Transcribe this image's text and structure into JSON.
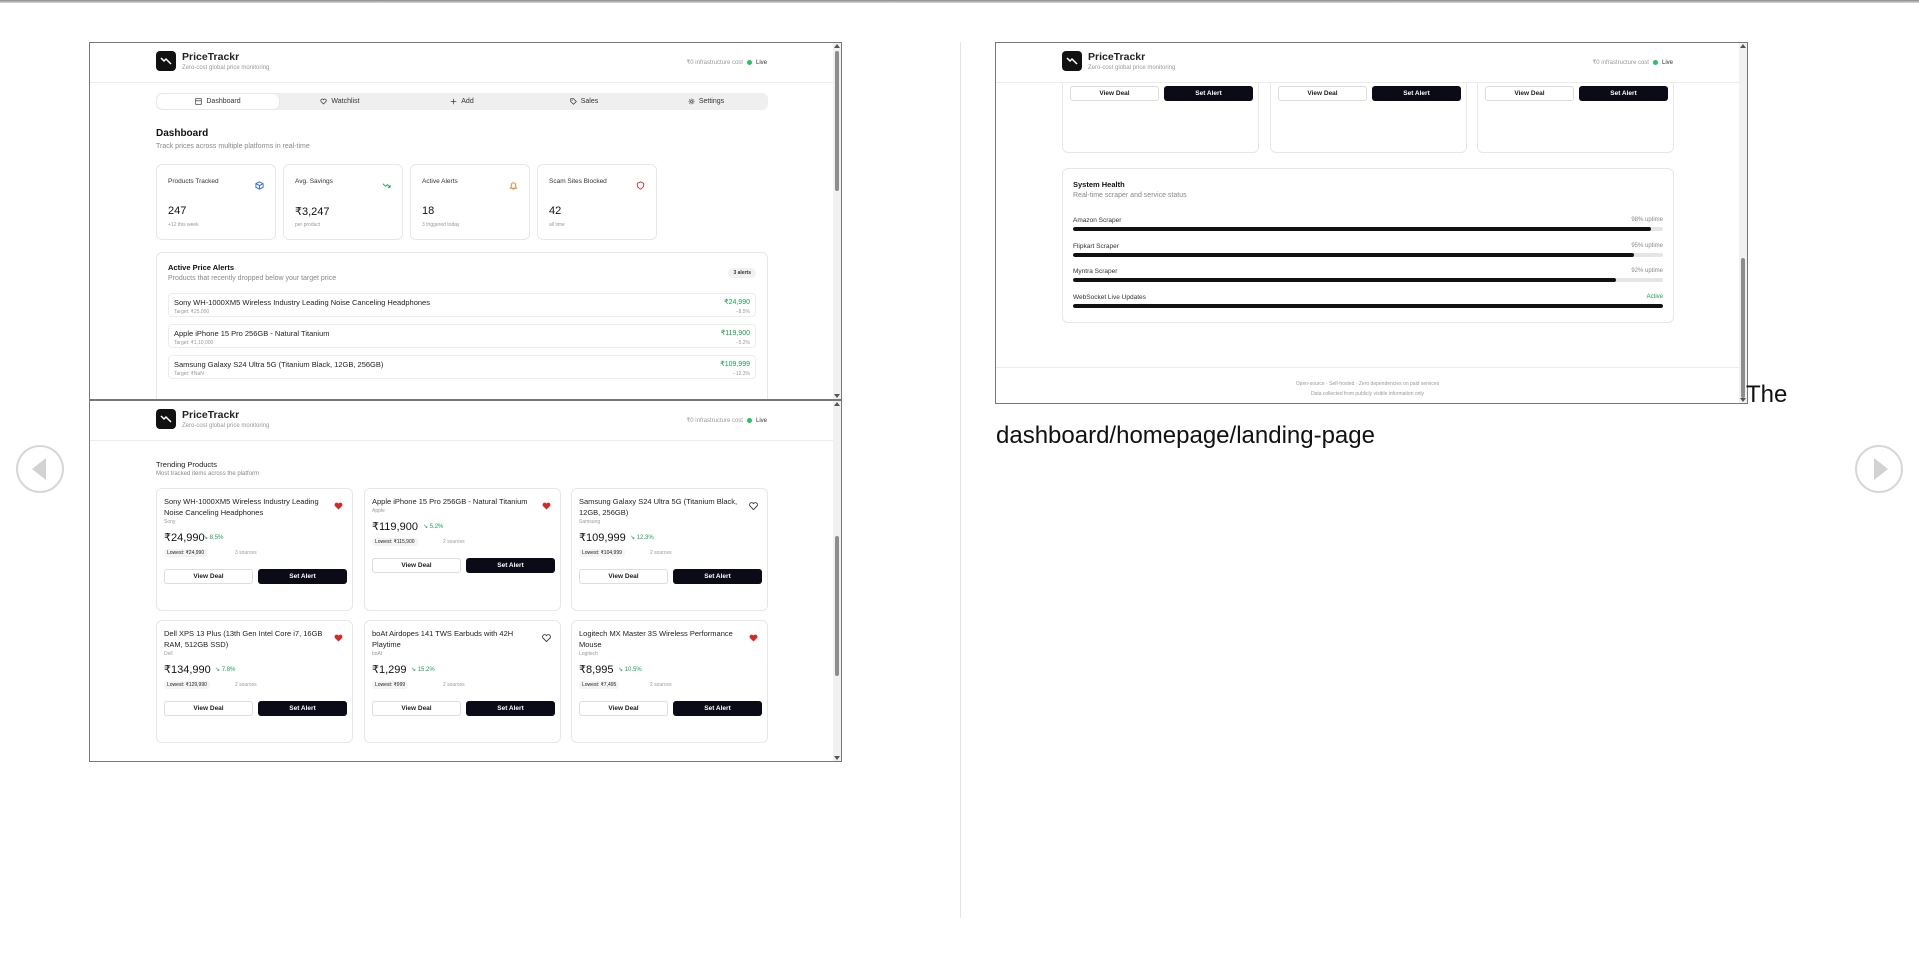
{
  "app": {
    "name": "PriceTrackr",
    "tagline": "Zero-cost global price monitoring",
    "infra": "₹0 infrastructure cost",
    "live": "Live"
  },
  "tabs": [
    {
      "label": "Dashboard",
      "icon": "dashboard-icon"
    },
    {
      "label": "Watchlist",
      "icon": "heart-icon"
    },
    {
      "label": "Add",
      "icon": "plus-icon"
    },
    {
      "label": "Sales",
      "icon": "tag-icon"
    },
    {
      "label": "Settings",
      "icon": "gear-icon"
    }
  ],
  "dashboard": {
    "title": "Dashboard",
    "subtitle": "Track prices across multiple platforms in real-time"
  },
  "stats": [
    {
      "label": "Products Tracked",
      "value": "247",
      "note": "+12 this week",
      "icon": "package-icon",
      "color": "#2563eb"
    },
    {
      "label": "Avg. Savings",
      "value": "₹3,247",
      "note": "per product",
      "icon": "trending-down-icon",
      "color": "#16a34a"
    },
    {
      "label": "Active Alerts",
      "value": "18",
      "note": "3 triggered today",
      "icon": "bell-icon",
      "color": "#f97316"
    },
    {
      "label": "Scam Sites Blocked",
      "value": "42",
      "note": "all time",
      "icon": "shield-icon",
      "color": "#dc2626"
    }
  ],
  "alerts": {
    "title": "Active Price Alerts",
    "subtitle": "Products that recently dropped below your target price",
    "badge": "3 alerts",
    "items": [
      {
        "name": "Sony WH-1000XM5 Wireless Industry Leading Noise Canceling Headphones",
        "target": "Target: ₹25,000",
        "price": "₹24,990",
        "change": "−8.5%"
      },
      {
        "name": "Apple iPhone 15 Pro 256GB - Natural Titanium",
        "target": "Target: ₹1,10,000",
        "price": "₹119,900",
        "change": "−5.2%"
      },
      {
        "name": "Samsung Galaxy S24 Ultra 5G (Titanium Black, 12GB, 256GB)",
        "target": "Target: ₹NaN",
        "price": "₹109,999",
        "change": "−12.3%"
      }
    ]
  },
  "trending": {
    "title": "Trending Products",
    "subtitle": "Most tracked items across the platform",
    "products": [
      {
        "name": "Sony WH-1000XM5 Wireless Industry Leading Noise Canceling Headphones",
        "brand": "Sony",
        "price": "₹24,990",
        "trend": "8.5%",
        "lowest": "Lowest: ₹24,990",
        "sources": "3 sources",
        "favorited": true
      },
      {
        "name": "Apple iPhone 15 Pro 256GB - Natural Titanium",
        "brand": "Apple",
        "price": "₹119,900",
        "trend": "5.2%",
        "lowest": "Lowest: ₹115,900",
        "sources": "2 sources",
        "favorited": true
      },
      {
        "name": "Samsung Galaxy S24 Ultra 5G (Titanium Black, 12GB, 256GB)",
        "brand": "Samsung",
        "price": "₹109,999",
        "trend": "12.3%",
        "lowest": "Lowest: ₹104,999",
        "sources": "2 sources",
        "favorited": false
      },
      {
        "name": "Dell XPS 13 Plus (13th Gen Intel Core i7, 16GB RAM, 512GB SSD)",
        "brand": "Dell",
        "price": "₹134,990",
        "trend": "7.8%",
        "lowest": "Lowest: ₹129,990",
        "sources": "2 sources",
        "favorited": true
      },
      {
        "name": "boAt Airdopes 141 TWS Earbuds with 42H Playtime",
        "brand": "boAt",
        "price": "₹1,299",
        "trend": "15.2%",
        "lowest": "Lowest: ₹999",
        "sources": "2 sources",
        "favorited": false
      },
      {
        "name": "Logitech MX Master 3S Wireless Performance Mouse",
        "brand": "Logitech",
        "price": "₹8,995",
        "trend": "10.5%",
        "lowest": "Lowest: ₹7,495",
        "sources": "2 sources",
        "favorited": true
      }
    ]
  },
  "buttons": {
    "view_deal": "View Deal",
    "set_alert": "Set Alert"
  },
  "health": {
    "title": "System Health",
    "subtitle": "Real-time scraper and service status",
    "services": [
      {
        "name": "Amazon Scraper",
        "status": "98% uptime",
        "level": 0.98
      },
      {
        "name": "Flipkart Scraper",
        "status": "95% uptime",
        "level": 0.95
      },
      {
        "name": "Myntra Scraper",
        "status": "92% uptime",
        "level": 0.92
      },
      {
        "name": "WebSocket Live Updates",
        "status": "Active",
        "level": 1.0,
        "status_color": "#16a34a"
      }
    ]
  },
  "footer": {
    "line1": "Open-source · Self-hosted · Zero dependencies on paid services",
    "line2": "Data collected from publicly visible information only"
  },
  "caption": {
    "lead": "The",
    "rest": "dashboard/homepage/landing-page"
  }
}
